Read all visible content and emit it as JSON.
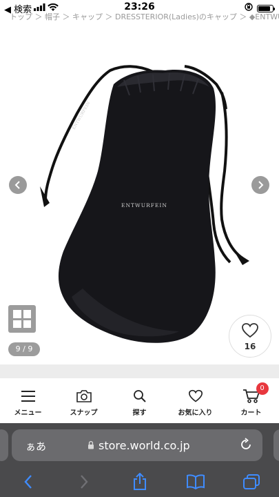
{
  "status_bar": {
    "back_app": "◀ 検索",
    "time": "23:26",
    "battery_level": 0.85
  },
  "breadcrumb": "トップ ＞ 帽子 ＞ キャップ ＞ DRESSTERIOR(Ladies)のキャップ ＞ ◆ENTWURFEIN",
  "gallery": {
    "bag_brand_text": "ENTWURFEIN",
    "string_text": "ENTWURFEIN",
    "page_counter": "9 / 9",
    "favorite_count": "16"
  },
  "bottom_menu": {
    "items": [
      {
        "label": "メニュー",
        "icon": "hamburger-icon"
      },
      {
        "label": "スナップ",
        "icon": "camera-icon"
      },
      {
        "label": "探す",
        "icon": "search-icon"
      },
      {
        "label": "お気に入り",
        "icon": "heart-icon"
      },
      {
        "label": "カート",
        "icon": "cart-icon"
      }
    ],
    "cart_badge": "0"
  },
  "browser": {
    "aa_label": "ぁあ",
    "url": "store.world.co.jp"
  },
  "colors": {
    "accent_badge": "#e8373e",
    "safari_bg": "#4a4a4c",
    "toolbar_icon": "#3f8cff"
  }
}
